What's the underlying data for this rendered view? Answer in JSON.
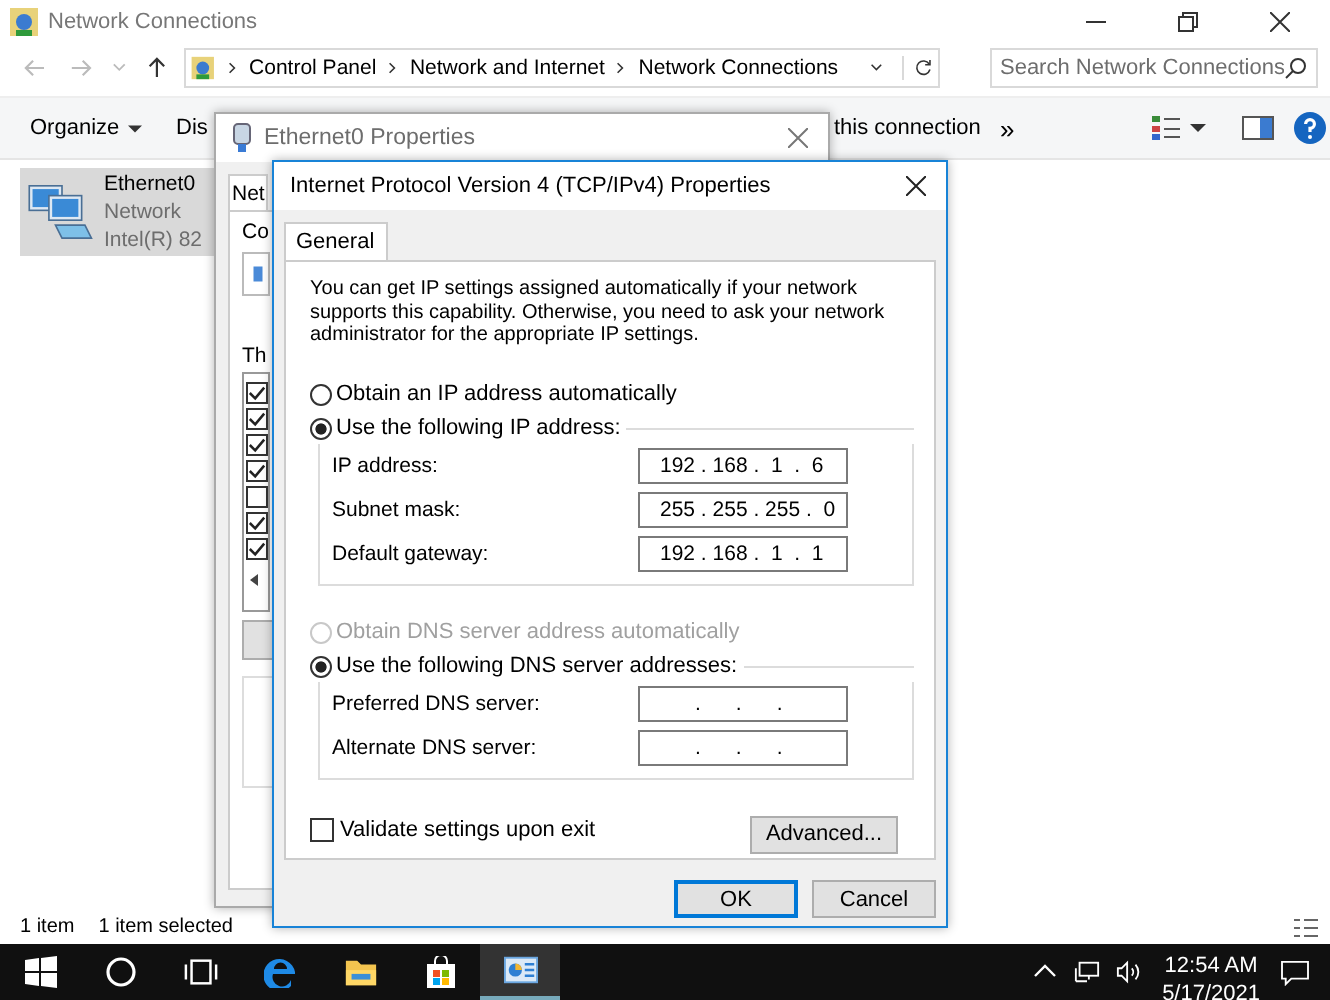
{
  "explorer": {
    "title": "Network Connections",
    "breadcrumbs": [
      "Control Panel",
      "Network and Internet",
      "Network Connections"
    ],
    "search": {
      "placeholder": "Search Network Connections"
    },
    "toolbar": [
      {
        "label": "Organize",
        "kind": "menu"
      },
      {
        "label": "Dis",
        "kind": "plain"
      },
      {
        "label": "this connection",
        "kind": "plain"
      },
      {
        "label": "»",
        "kind": "overflow"
      }
    ],
    "items": [
      {
        "name": "Ethernet0",
        "lines": [
          "Network",
          "Intel(R) 82"
        ],
        "selected": true
      }
    ],
    "status": [
      "1 item",
      "1 item selected"
    ]
  },
  "ethernet_dialog": {
    "title": "Ethernet0 Properties",
    "tab": "Net",
    "labels": [
      "Co",
      "Th"
    ],
    "components": [
      {
        "checked": true
      },
      {
        "checked": true
      },
      {
        "checked": true
      },
      {
        "checked": true
      },
      {
        "checked": false
      },
      {
        "checked": true
      },
      {
        "checked": true
      }
    ]
  },
  "ipv4_dialog": {
    "title": "Internet Protocol Version 4 (TCP/IPv4) Properties",
    "tabs": [
      {
        "label": "General",
        "selected": true
      }
    ],
    "intro": "You can get IP settings assigned automatically if your network supports this capability. Otherwise, you need to ask your network administrator for the appropriate IP settings.",
    "ip_mode": [
      {
        "label": "Obtain an IP address automatically",
        "selected": false,
        "disabled": false
      },
      {
        "label": "Use the following IP address:",
        "selected": true,
        "disabled": false
      }
    ],
    "ip_fields": [
      {
        "label": "IP address:",
        "value": "192 . 168 .  1  .  6"
      },
      {
        "label": "Subnet mask:",
        "value": "255 . 255 . 255 .  0"
      },
      {
        "label": "Default gateway:",
        "value": "192 . 168 .  1  .  1"
      }
    ],
    "dns_mode": [
      {
        "label": "Obtain DNS server address automatically",
        "selected": false,
        "disabled": true
      },
      {
        "label": "Use the following DNS server addresses:",
        "selected": true,
        "disabled": false
      }
    ],
    "dns_fields": [
      {
        "label": "Preferred DNS server:",
        "value": "      .      .      ."
      },
      {
        "label": "Alternate DNS server:",
        "value": "      .      .      ."
      }
    ],
    "validate": {
      "label": "Validate settings upon exit",
      "checked": false
    },
    "advanced": "Advanced...",
    "buttons": [
      {
        "label": "OK",
        "default": true
      },
      {
        "label": "Cancel",
        "default": false
      }
    ]
  },
  "taskbar": {
    "apps": [
      {
        "kind": "start",
        "selected": false
      },
      {
        "kind": "search",
        "selected": false
      },
      {
        "kind": "taskview",
        "selected": false
      },
      {
        "kind": "browser",
        "selected": false
      },
      {
        "kind": "folder",
        "selected": false
      },
      {
        "kind": "store",
        "selected": false
      },
      {
        "kind": "control",
        "selected": true
      }
    ],
    "time": "12:54 AM",
    "date": "5/17/2021"
  }
}
